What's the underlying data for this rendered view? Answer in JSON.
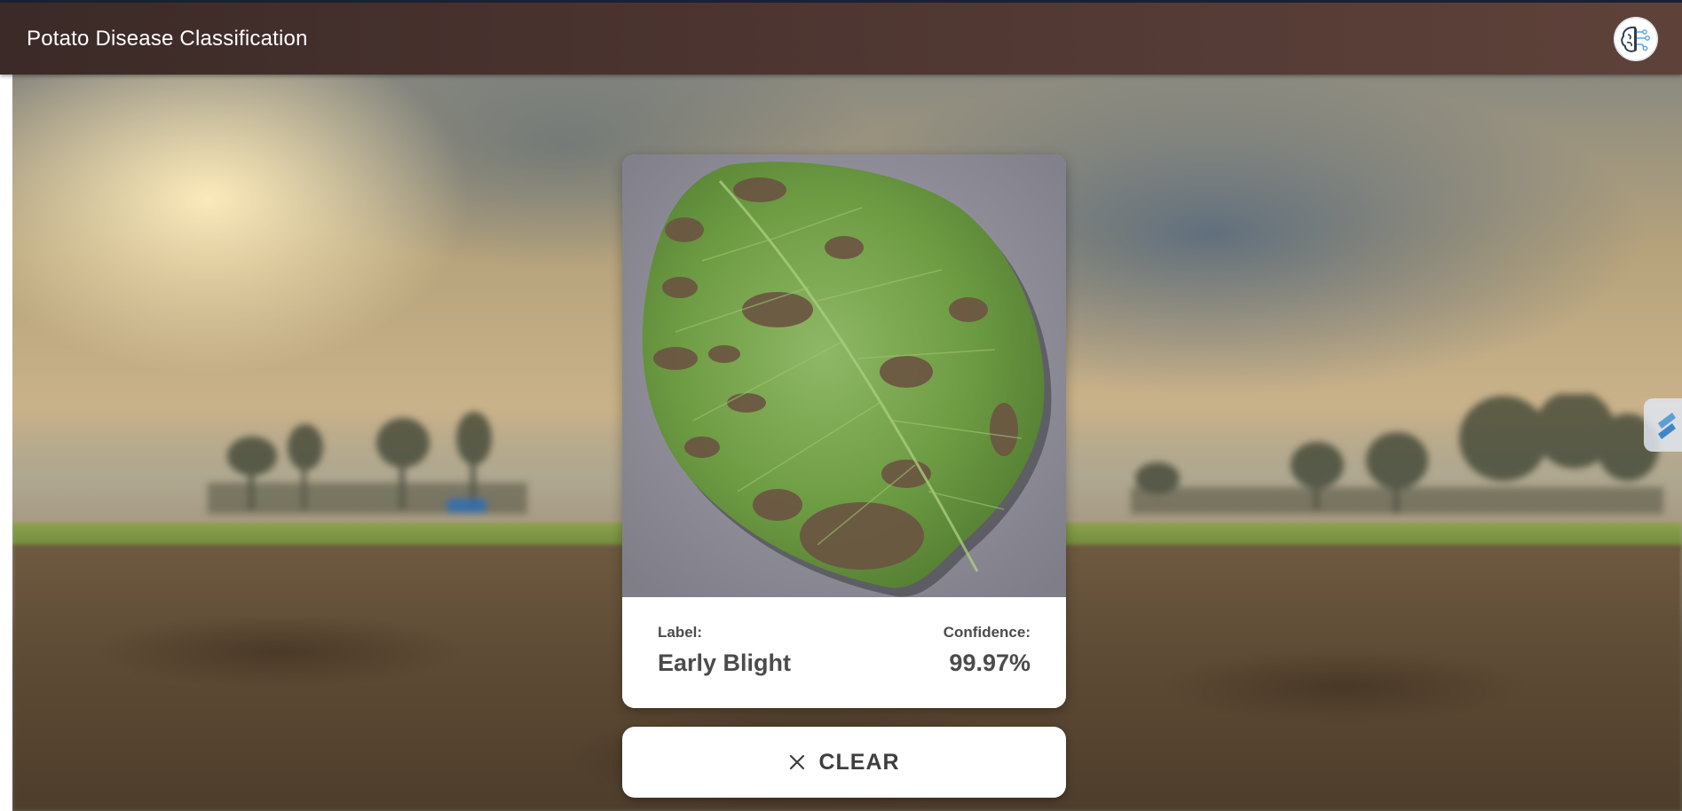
{
  "header": {
    "title": "Potato Disease Classification",
    "logo_icon": "brain-circuit-icon"
  },
  "side_tab": {
    "icon": "streamlit-tab-icon"
  },
  "upload_card": {
    "image_alt": "Uploaded potato leaf",
    "label_heading": "Label:",
    "label_value": "Early Blight",
    "confidence_heading": "Confidence:",
    "confidence_value": "99.97%"
  },
  "clear_button": {
    "label": "CLEAR",
    "icon": "close-icon"
  },
  "colors": {
    "appbar_start": "#3b2a27",
    "appbar_end": "#5e423a",
    "card_bg": "#ffffff",
    "text_dark": "#4b4b4b"
  }
}
